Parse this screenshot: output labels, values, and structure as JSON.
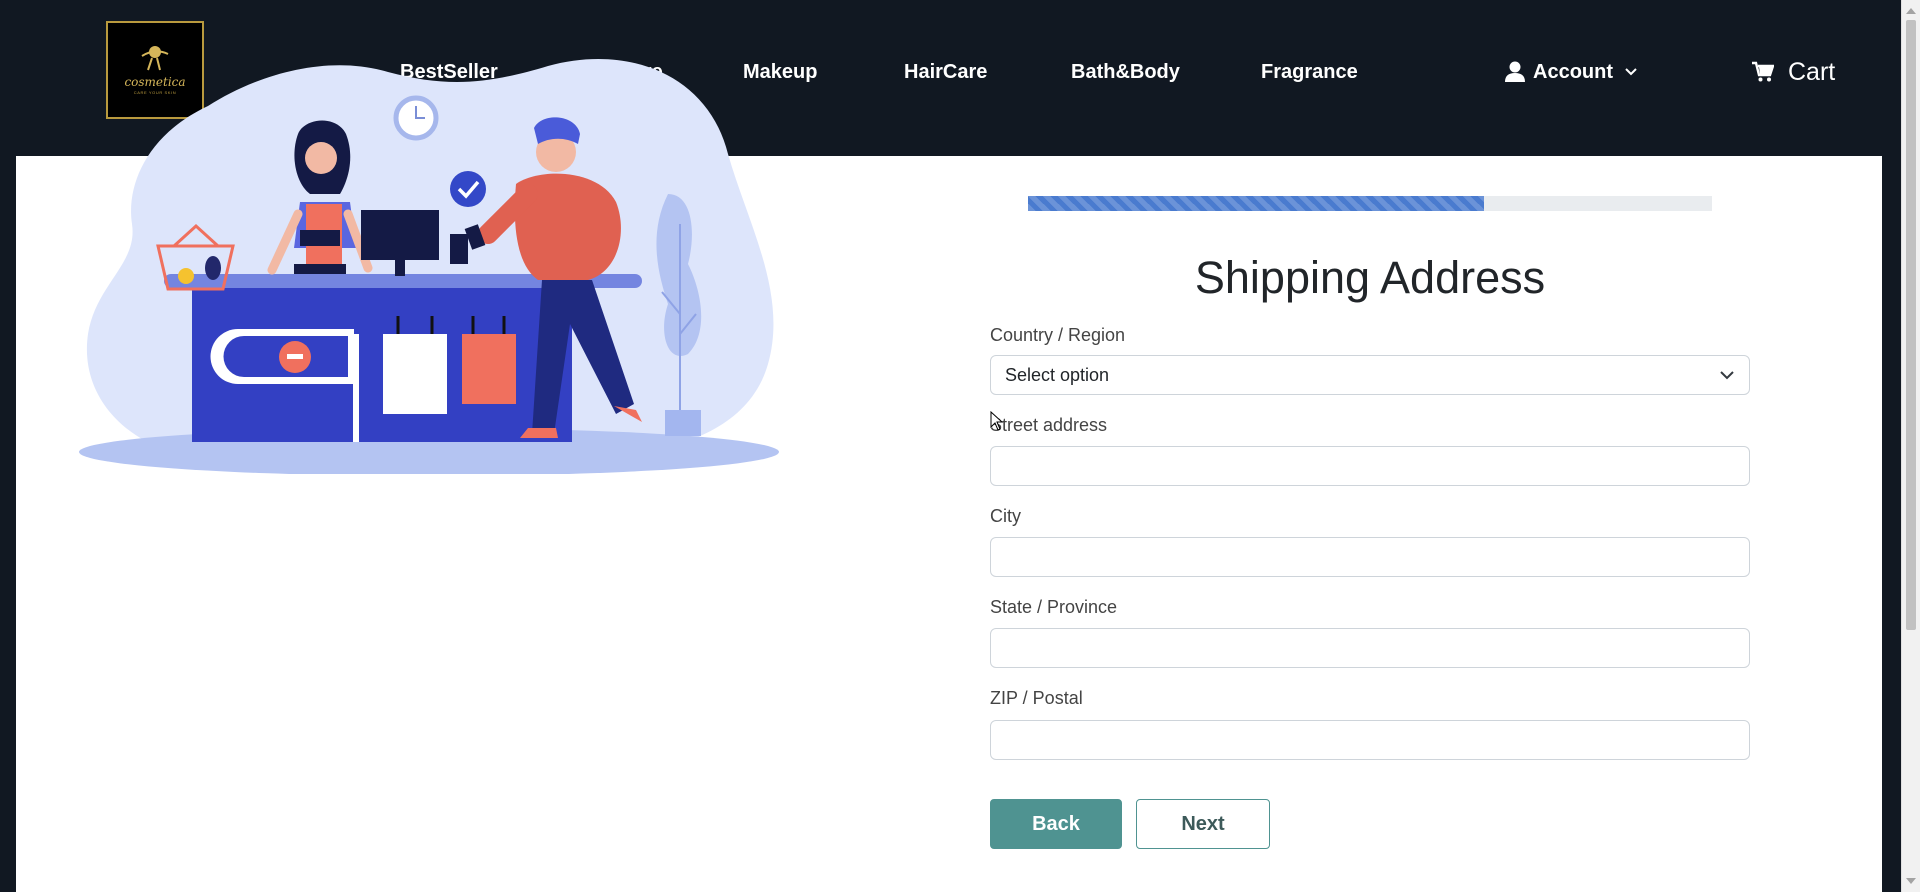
{
  "brand": {
    "name": "cosmetica",
    "tagline": "CARE YOUR SKIN"
  },
  "nav": {
    "links": [
      "BestSeller",
      "SkinCare",
      "Makeup",
      "HairCare",
      "Bath&Body",
      "Fragrance"
    ],
    "account_label": "Account",
    "cart_label": "Cart"
  },
  "progress": {
    "value_percent": 66.7
  },
  "form": {
    "title": "Shipping Address",
    "country_label": "Country / Region",
    "country_selected": "Select option",
    "street_label": "Street address",
    "city_label": "City",
    "state_label": "State / Province",
    "zip_label": "ZIP / Postal",
    "street_value": "",
    "city_value": "",
    "state_value": "",
    "zip_value": ""
  },
  "buttons": {
    "back": "Back",
    "next": "Next"
  },
  "colors": {
    "nav_bg": "#111822",
    "accent": "#4f9391",
    "progress": "#4a7bcf"
  }
}
